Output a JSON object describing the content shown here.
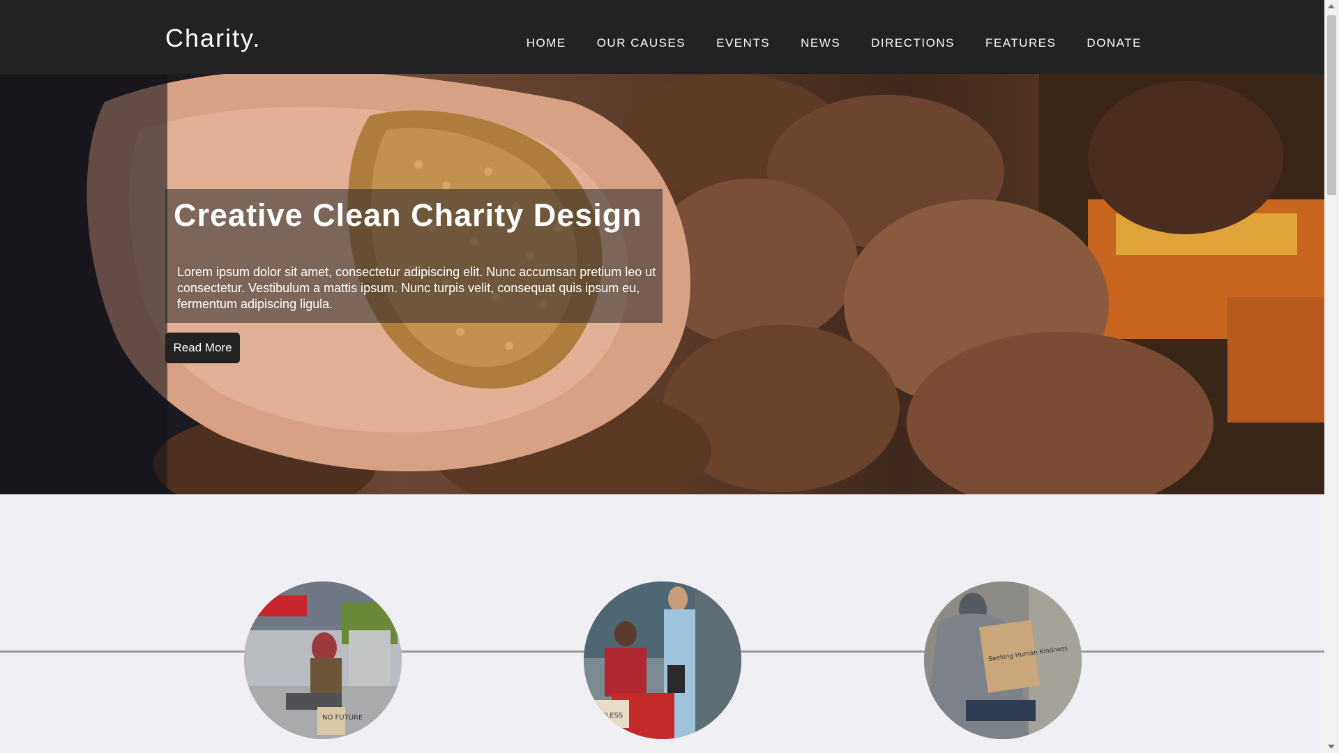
{
  "nav": {
    "brand": "Charity.",
    "links": [
      "HOME",
      "OUR CAUSES",
      "EVENTS",
      "NEWS",
      "DIRECTIONS",
      "FEATURES",
      "DONATE"
    ]
  },
  "hero": {
    "title": "Creative Clean Charity Design",
    "text": "Lorem ipsum dolor sit amet, consectetur adipiscing elit. Nunc accumsan pretium leo ut consectetur. Vestibulum a mattis ipsum. Nunc turpis velit, consequat quis ipsum eu, fermentum adipiscing ligula.",
    "button_label": "Read More"
  },
  "causes": {
    "items": [
      {
        "sign": "NO FUTURE"
      },
      {
        "sign": "JOBLESS"
      },
      {
        "sign": "Seeking Human Kindness"
      }
    ]
  },
  "colors": {
    "navbar_bg": "#222222",
    "page_bg": "#f0f0f4",
    "overlay": "rgba(40,40,40,0.55)",
    "button_bg": "#222222",
    "divider": "#9a9a9a"
  }
}
